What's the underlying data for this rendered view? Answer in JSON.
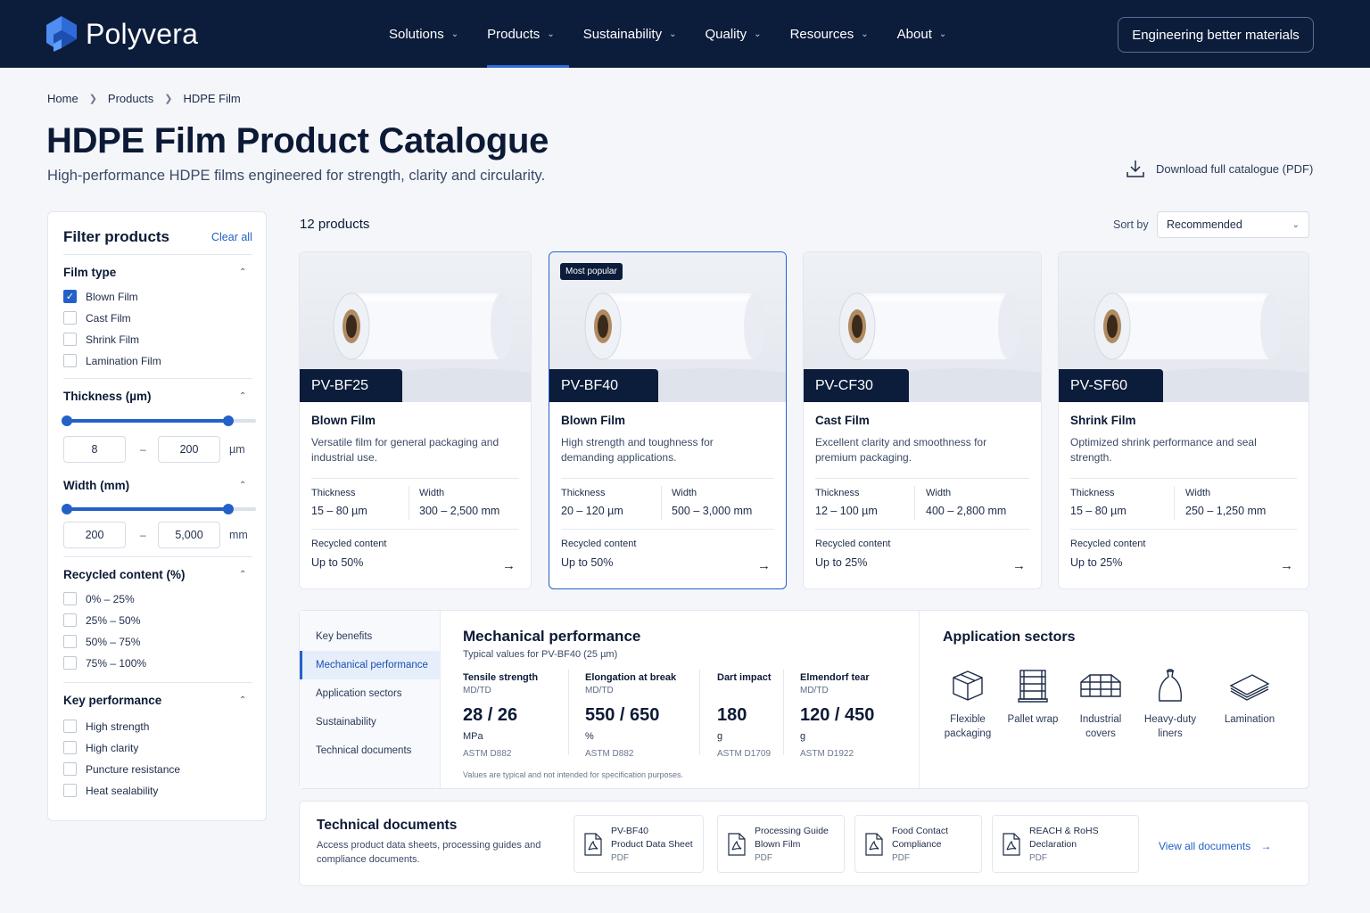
{
  "brand": {
    "name": "Polyvera"
  },
  "nav": {
    "items": [
      {
        "label": "Solutions"
      },
      {
        "label": "Products",
        "active": true
      },
      {
        "label": "Sustainability"
      },
      {
        "label": "Quality"
      },
      {
        "label": "Resources"
      },
      {
        "label": "About"
      }
    ],
    "cta": "Engineering better materials"
  },
  "breadcrumb": [
    "Home",
    "Products",
    "HDPE Film"
  ],
  "page": {
    "title": "HDPE Film Product Catalogue",
    "subtitle": "High-performance HDPE films engineered for strength, clarity and circularity.",
    "download": "Download full catalogue (PDF)"
  },
  "filters": {
    "title": "Filter products",
    "clear": "Clear all",
    "film_type": {
      "label": "Film type",
      "options": [
        "Blown Film",
        "Cast Film",
        "Shrink Film",
        "Lamination Film"
      ],
      "checked": [
        "Blown Film"
      ]
    },
    "thickness": {
      "label": "Thickness (µm)",
      "min": "8",
      "max": "200",
      "unit": "µm",
      "dash": "–"
    },
    "width": {
      "label": "Width (mm)",
      "min": "200",
      "max": "5,000",
      "unit": "mm",
      "dash": "–"
    },
    "recycled": {
      "label": "Recycled content (%)",
      "options": [
        "0% – 25%",
        "25% – 50%",
        "50% – 75%",
        "75% – 100%"
      ]
    },
    "performance": {
      "label": "Key performance",
      "options": [
        "High strength",
        "High clarity",
        "Puncture resistance",
        "Heat sealability"
      ]
    }
  },
  "listing": {
    "count": "12 products",
    "sort_label": "Sort by",
    "sort_value": "Recommended"
  },
  "products": [
    {
      "code": "PV-BF25",
      "name": "Blown Film",
      "desc": "Versatile film for general packaging and industrial use.",
      "thickness_label": "Thickness",
      "thickness": "15 – 80 µm",
      "width_label": "Width",
      "width": "300 – 2,500 mm",
      "recycled_label": "Recycled content",
      "recycled": "Up to 50%"
    },
    {
      "code": "PV-BF40",
      "badge": "Most popular",
      "name": "Blown Film",
      "desc": "High strength and toughness for demanding applications.",
      "thickness_label": "Thickness",
      "thickness": "20 – 120 µm",
      "width_label": "Width",
      "width": "500 – 3,000 mm",
      "recycled_label": "Recycled content",
      "recycled": "Up to 50%"
    },
    {
      "code": "PV-CF30",
      "name": "Cast Film",
      "desc": "Excellent clarity and smoothness for premium packaging.",
      "thickness_label": "Thickness",
      "thickness": "12 – 100 µm",
      "width_label": "Width",
      "width": "400 – 2,800 mm",
      "recycled_label": "Recycled content",
      "recycled": "Up to 25%"
    },
    {
      "code": "PV-SF60",
      "name": "Shrink Film",
      "desc": "Optimized shrink performance and seal strength.",
      "thickness_label": "Thickness",
      "thickness": "15 – 80 µm",
      "width_label": "Width",
      "width": "250 – 1,250 mm",
      "recycled_label": "Recycled content",
      "recycled": "Up to 25%"
    }
  ],
  "details": {
    "tabs": [
      "Key benefits",
      "Mechanical performance",
      "Application sectors",
      "Sustainability",
      "Technical documents"
    ],
    "active_tab": "Mechanical performance",
    "mech": {
      "title": "Mechanical performance",
      "subtitle": "Typical values for PV-BF40 (25 µm)",
      "metrics": [
        {
          "name": "Tensile strength",
          "dir": "MD/TD",
          "value": "28 / 26",
          "unit": "MPa",
          "std": "ASTM D882"
        },
        {
          "name": "Elongation at break",
          "dir": "MD/TD",
          "value": "550 / 650",
          "unit": "%",
          "std": "ASTM D882"
        },
        {
          "name": "Dart impact",
          "dir": "",
          "value": "180",
          "unit": "g",
          "std": "ASTM D1709"
        },
        {
          "name": "Elmendorf tear",
          "dir": "MD/TD",
          "value": "120 / 450",
          "unit": "g",
          "std": "ASTM D1922"
        }
      ],
      "note": "Values are typical and not intended for specification purposes."
    },
    "sectors": {
      "title": "Application sectors",
      "items": [
        {
          "label": "Flexible packaging",
          "icon": "box-icon"
        },
        {
          "label": "Pallet wrap",
          "icon": "pallet-wrap-icon"
        },
        {
          "label": "Industrial covers",
          "icon": "industrial-cover-icon"
        },
        {
          "label": "Heavy-duty liners",
          "icon": "liner-bag-icon"
        },
        {
          "label": "Lamination",
          "icon": "lamination-icon"
        }
      ]
    }
  },
  "documents": {
    "title": "Technical documents",
    "subtitle": "Access product data sheets, processing guides and compliance documents.",
    "items": [
      {
        "line1": "PV-BF40",
        "line2": "Product Data Sheet",
        "format": "PDF"
      },
      {
        "line1": "Processing Guide",
        "line2": "Blown Film",
        "format": "PDF"
      },
      {
        "line1": "Food Contact",
        "line2": "Compliance",
        "format": "PDF"
      },
      {
        "line1": "REACH & RoHS",
        "line2": "Declaration",
        "format": "PDF"
      }
    ],
    "view_all": "View all documents"
  },
  "colors": {
    "navy": "#0c1c3b",
    "accent": "#2361c9",
    "background": "#f4f6fa"
  }
}
